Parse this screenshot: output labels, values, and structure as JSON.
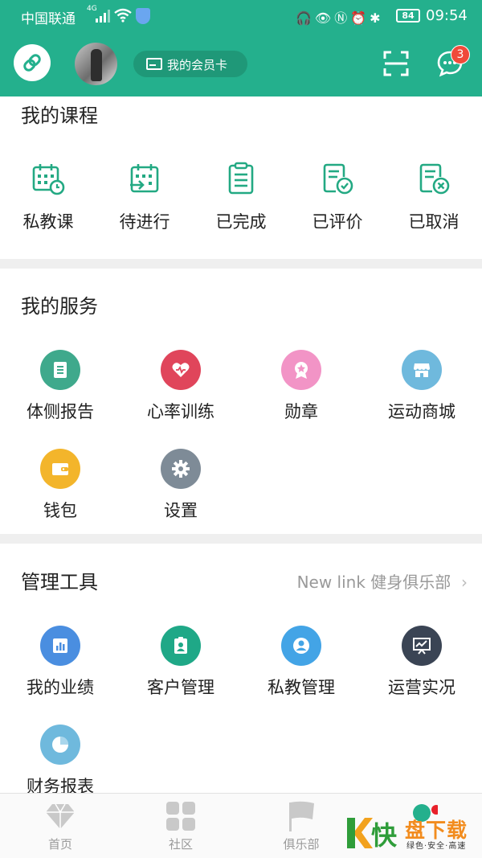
{
  "status_bar": {
    "carrier": "中国联通",
    "network": "4G",
    "battery": "84",
    "time": "09:54"
  },
  "header": {
    "member_card_label": "我的会员卡",
    "message_badge": "3",
    "accent_color": "#24b08d"
  },
  "courses": {
    "title": "我的课程",
    "items": [
      {
        "label": "私教课",
        "icon": "calendar-clock-icon"
      },
      {
        "label": "待进行",
        "icon": "calendar-arrow-icon"
      },
      {
        "label": "已完成",
        "icon": "clipboard-list-icon"
      },
      {
        "label": "已评价",
        "icon": "document-check-icon"
      },
      {
        "label": "已取消",
        "icon": "document-cancel-icon"
      }
    ]
  },
  "services": {
    "title": "我的服务",
    "items": [
      {
        "label": "体侧报告",
        "icon": "report-icon",
        "color": "#3fa98c"
      },
      {
        "label": "心率训练",
        "icon": "heart-rate-icon",
        "color": "#e0455b"
      },
      {
        "label": "勋章",
        "icon": "medal-icon",
        "color": "#f294c6"
      },
      {
        "label": "运动商城",
        "icon": "store-icon",
        "color": "#6fb9dd"
      },
      {
        "label": "钱包",
        "icon": "wallet-icon",
        "color": "#f3b52b"
      },
      {
        "label": "设置",
        "icon": "gear-icon",
        "color": "#7e8b97"
      }
    ]
  },
  "tools": {
    "title": "管理工具",
    "club_link": "New link 健身俱乐部",
    "items": [
      {
        "label": "我的业绩",
        "icon": "bar-chart-icon",
        "color": "#4a8ee0"
      },
      {
        "label": "客户管理",
        "icon": "contact-card-icon",
        "color": "#1fa887"
      },
      {
        "label": "私教管理",
        "icon": "person-icon",
        "color": "#43a4e6"
      },
      {
        "label": "运营实况",
        "icon": "presentation-icon",
        "color": "#3a4454"
      },
      {
        "label": "财务报表",
        "icon": "pie-chart-icon",
        "color": "#6fb9dd"
      }
    ]
  },
  "bottom_nav": {
    "items": [
      {
        "label": "首页",
        "icon": "diamond-icon"
      },
      {
        "label": "社区",
        "icon": "grid-icon"
      },
      {
        "label": "俱乐部",
        "icon": "flag-icon"
      },
      {
        "label": "",
        "icon": "profile-icon"
      }
    ]
  },
  "watermark": {
    "brand_char": "快",
    "brand_text": "盘下载",
    "tagline": "绿色·安全·高速"
  }
}
